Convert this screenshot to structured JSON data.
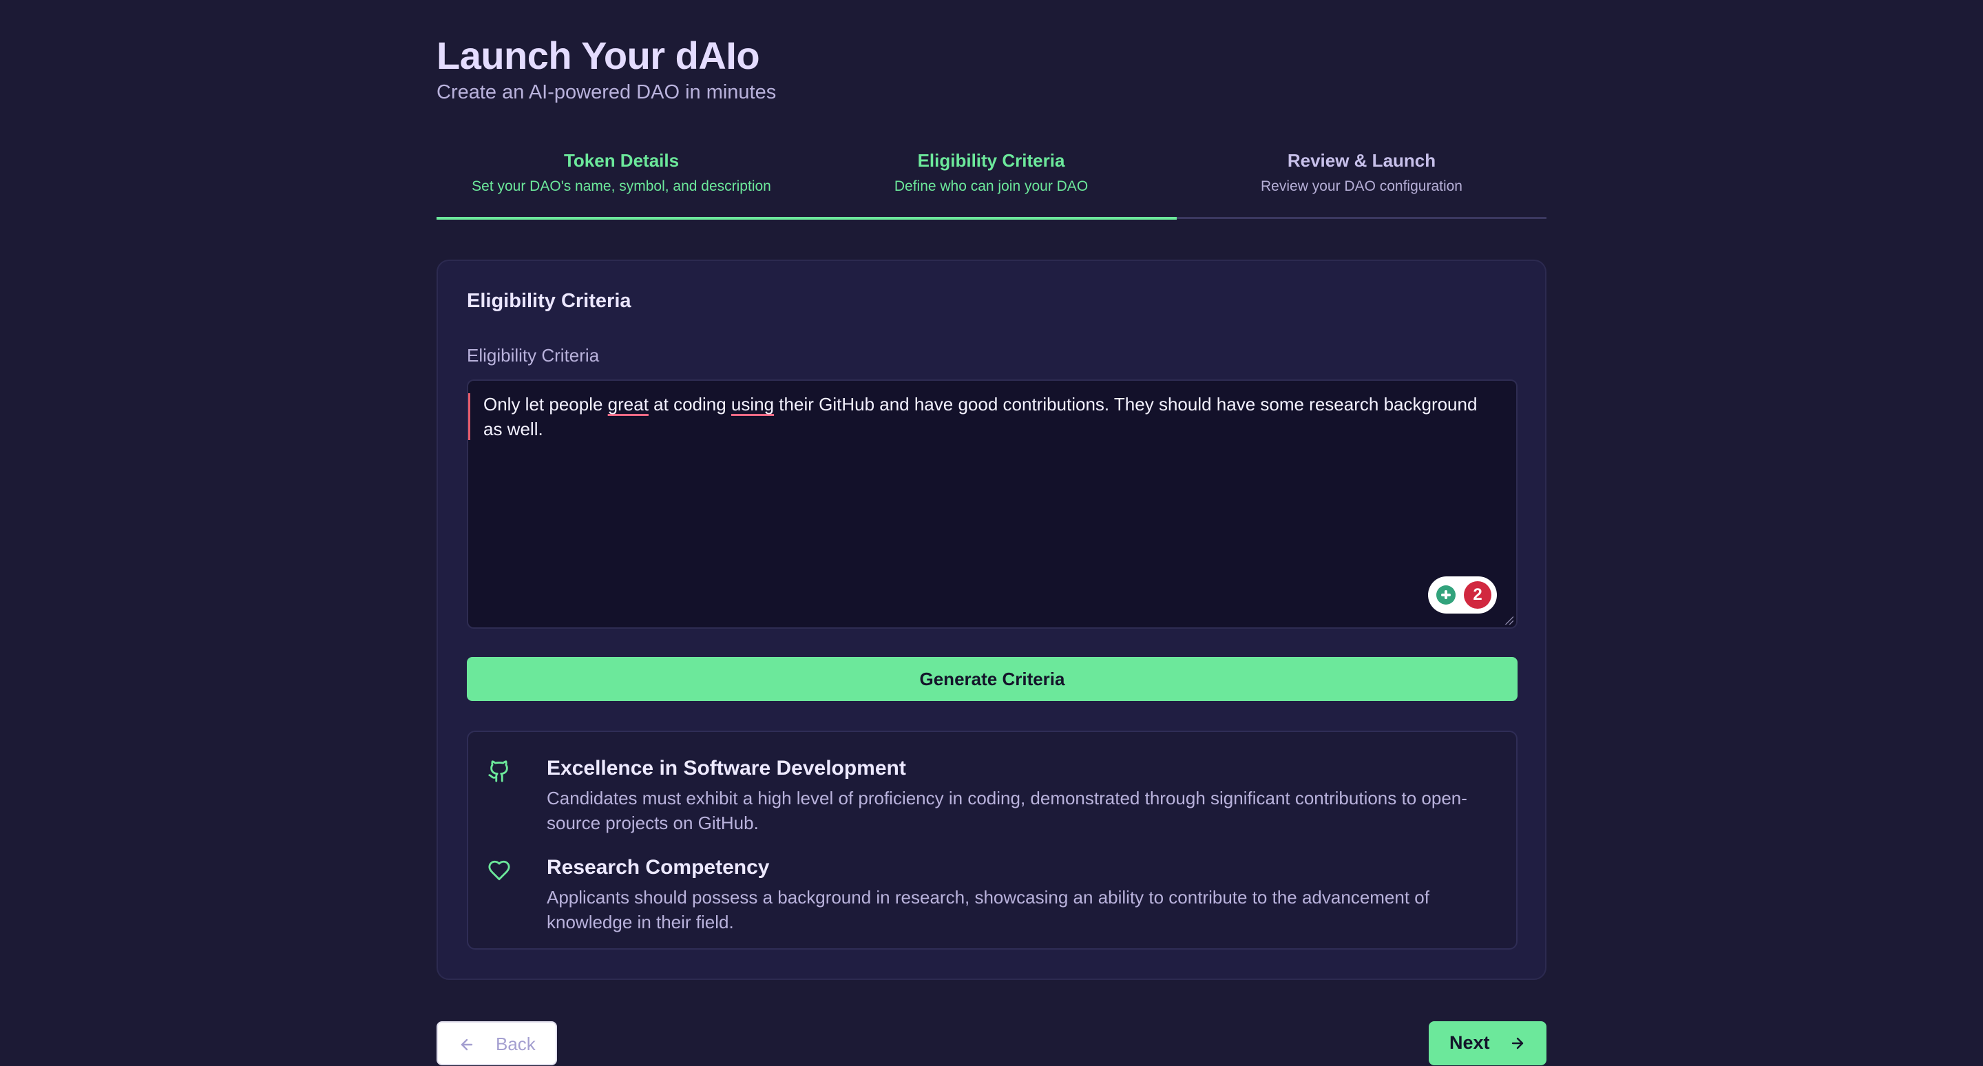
{
  "header": {
    "title": "Launch Your dAIo",
    "subtitle": "Create an AI-powered DAO in minutes"
  },
  "steps": [
    {
      "title": "Token Details",
      "description": "Set your DAO's name, symbol, and description",
      "state": "complete"
    },
    {
      "title": "Eligibility Criteria",
      "description": "Define who can join your DAO",
      "state": "current"
    },
    {
      "title": "Review & Launch",
      "description": "Review your DAO configuration",
      "state": "upcoming"
    }
  ],
  "card": {
    "heading": "Eligibility Criteria",
    "field_label": "Eligibility Criteria",
    "textarea": {
      "text_before_1": "Only let people ",
      "spell_1": "great",
      "text_between": " at coding ",
      "spell_2": "using",
      "text_after": " their GitHub and have good contributions. They should have some research background as well."
    },
    "grammar_badge": {
      "count": "2",
      "icon": "grammarly-icon"
    },
    "generate_label": "Generate Criteria",
    "criteria": [
      {
        "icon": "github-icon",
        "title": "Excellence in Software Development",
        "description": "Candidates must exhibit a high level of proficiency in coding, demonstrated through significant contributions to open-source projects on GitHub."
      },
      {
        "icon": "heart-icon",
        "title": "Research Competency",
        "description": "Applicants should possess a background in research, showcasing an ability to contribute to the advancement of knowledge in their field."
      }
    ]
  },
  "footer": {
    "back_label": "Back",
    "next_label": "Next"
  },
  "colors": {
    "background": "#1c1a35",
    "accent": "#6ce89b",
    "card": "#201e42",
    "textarea": "#13112a"
  }
}
